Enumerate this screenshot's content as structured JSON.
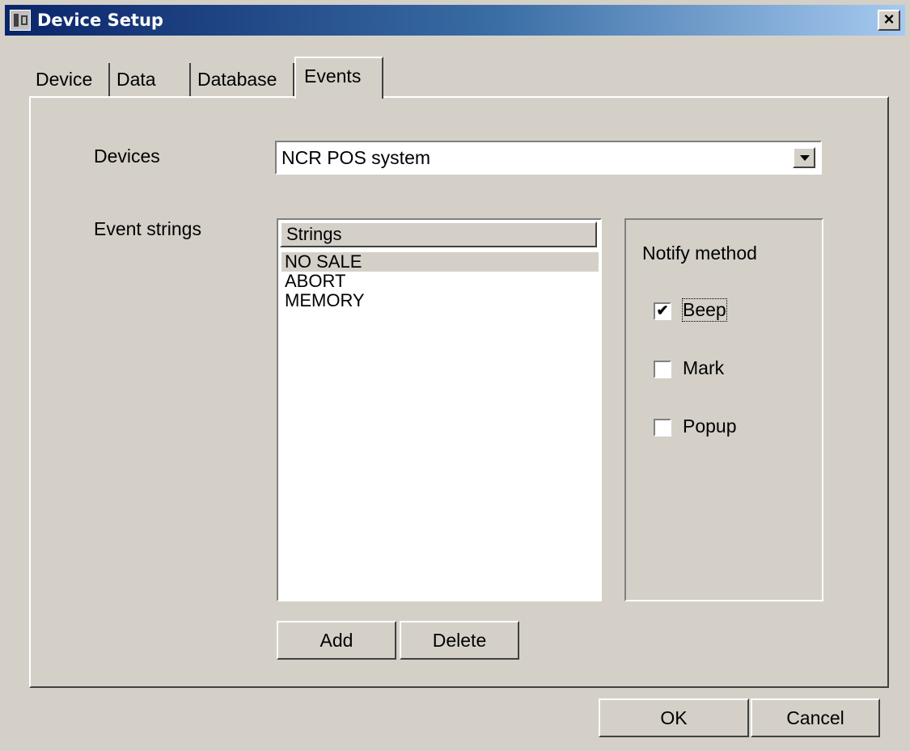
{
  "window": {
    "title": "Device Setup",
    "close_label": "×"
  },
  "tabs": [
    {
      "label": "Device"
    },
    {
      "label": "Data"
    },
    {
      "label": "Databasе"
    },
    {
      "label": "Events",
      "active": true
    }
  ],
  "events": {
    "devices_label": "Devices",
    "devices_value": "NCR POS system",
    "event_strings_label": "Event strings",
    "list_header": "Strings",
    "strings": [
      "NO SALE",
      "ABORT",
      "MEMORY"
    ],
    "selected_index": 0,
    "notify": {
      "title": "Notify method",
      "options": [
        {
          "label": "Beep",
          "checked": true
        },
        {
          "label": "Mark",
          "checked": false
        },
        {
          "label": "Popup",
          "checked": false
        }
      ]
    },
    "add_label": "Add",
    "delete_label": "Delete"
  },
  "footer": {
    "ok_label": "OK",
    "cancel_label": "Cancel"
  }
}
